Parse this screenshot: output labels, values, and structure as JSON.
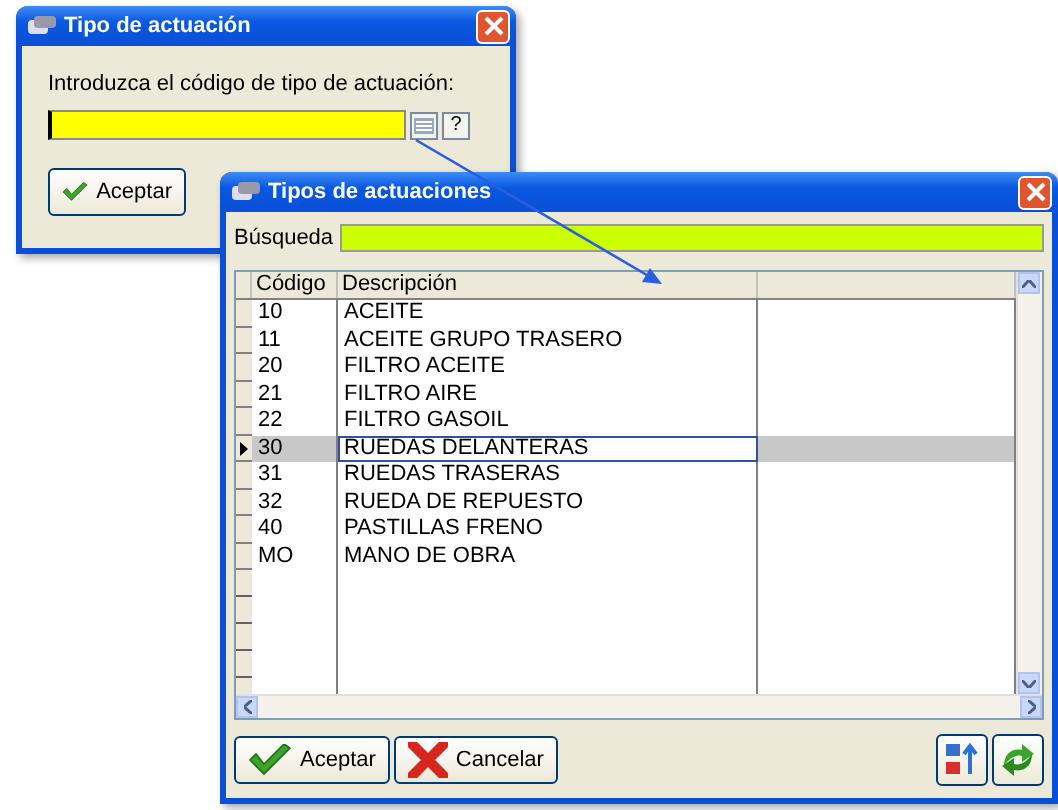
{
  "dialog": {
    "title": "Tipo de actuación",
    "prompt": "Introduzca el código de tipo de actuación:",
    "lookup_button": "?",
    "ok_button": "Aceptar"
  },
  "lookup_window": {
    "title": "Tipos de actuaciones",
    "search": {
      "label": "Búsqueda"
    },
    "table": {
      "columns": [
        "Código",
        "Descripción"
      ],
      "rows": [
        {
          "code": "10",
          "description": "ACEITE",
          "selected": false
        },
        {
          "code": "11",
          "description": "ACEITE GRUPO TRASERO",
          "selected": false
        },
        {
          "code": "20",
          "description": "FILTRO ACEITE",
          "selected": false
        },
        {
          "code": "21",
          "description": "FILTRO AIRE",
          "selected": false
        },
        {
          "code": "22",
          "description": "FILTRO GASOIL",
          "selected": false
        },
        {
          "code": "30",
          "description": "RUEDAS DELANTERAS",
          "selected": true
        },
        {
          "code": "31",
          "description": "RUEDAS TRASERAS",
          "selected": false
        },
        {
          "code": "32",
          "description": "RUEDA DE REPUESTO",
          "selected": false
        },
        {
          "code": "40",
          "description": "PASTILLAS FRENO",
          "selected": false
        },
        {
          "code": "MO",
          "description": "MANO DE OBRA",
          "selected": false
        }
      ]
    },
    "buttons": [
      "Aceptar",
      "Cancelar"
    ]
  }
}
